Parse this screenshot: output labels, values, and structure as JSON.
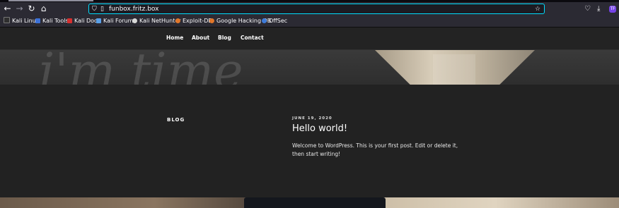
{
  "browser": {
    "url": "funbox.fritz.box",
    "icons": {
      "back": "back-arrow-icon",
      "forward": "forward-arrow-icon",
      "reload": "reload-icon",
      "home": "home-icon",
      "shield": "shield-icon",
      "lock": "page-lock-icon",
      "star": "star-icon",
      "pocket": "pocket-icon",
      "downloads": "download-icon",
      "extension": "extension-icon"
    },
    "extension_badge": "TF",
    "bookmarks": [
      {
        "label": "Kali Linux",
        "color": "#2f2f2f"
      },
      {
        "label": "Kali Tools",
        "color": "#3c71d8"
      },
      {
        "label": "Kali Docs",
        "color": "#d62f2f"
      },
      {
        "label": "Kali Forums",
        "color": "#5aa0e8"
      },
      {
        "label": "Kali NetHunter",
        "color": "#d8d8d8"
      },
      {
        "label": "Exploit-DB",
        "color": "#e0762a"
      },
      {
        "label": "Google Hacking DB",
        "color": "#e0762a"
      },
      {
        "label": "OffSec",
        "color": "#3d7bd9"
      }
    ]
  },
  "site": {
    "nav": [
      "Home",
      "About",
      "Blog",
      "Contact"
    ],
    "hero_text": "i'm time",
    "section_title": "BLOG",
    "post": {
      "date": "JUNE 19, 2020",
      "title": "Hello world!",
      "body": "Welcome to WordPress. This is your first post. Edit or delete it, then start writing!"
    }
  },
  "colors": {
    "accent": "#00ddff",
    "toolbar": "#2b2a33",
    "site_bg": "#222222"
  }
}
